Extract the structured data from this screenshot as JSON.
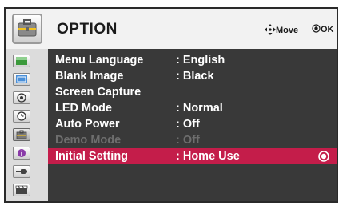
{
  "header": {
    "title": "OPTION",
    "icon": "option-toolbox-icon",
    "hint_move": "Move",
    "hint_move_icon": "dpad-arrows-icon",
    "hint_ok": "OK",
    "hint_ok_icon": "ok-button-icon"
  },
  "sidebar": {
    "items": [
      {
        "icon": "picture-icon",
        "selected": false
      },
      {
        "icon": "screen-icon",
        "selected": false
      },
      {
        "icon": "audio-icon",
        "selected": false
      },
      {
        "icon": "clock-icon",
        "selected": false
      },
      {
        "icon": "option-icon",
        "selected": true
      },
      {
        "icon": "info-icon",
        "selected": false
      },
      {
        "icon": "input-icon",
        "selected": false
      },
      {
        "icon": "media-icon",
        "selected": false
      }
    ]
  },
  "menu": {
    "items": [
      {
        "label": "Menu Language",
        "value": ": English",
        "state": "normal"
      },
      {
        "label": "Blank Image",
        "value": ": Black",
        "state": "normal"
      },
      {
        "label": "Screen Capture",
        "value": "",
        "state": "normal"
      },
      {
        "label": "LED Mode",
        "value": ": Normal",
        "state": "normal"
      },
      {
        "label": "Auto Power",
        "value": ": Off",
        "state": "normal"
      },
      {
        "label": "Demo Mode",
        "value": ": Off",
        "state": "disabled"
      },
      {
        "label": "Initial Setting",
        "value": ": Home Use",
        "state": "selected"
      }
    ]
  },
  "colors": {
    "selection": "#c41d4a",
    "panel_bg": "#393939",
    "header_bg": "#f2f2f2",
    "sidebar_bg": "#dcdcdc",
    "text": "#ffffff",
    "disabled_text": "#6e6e6e"
  }
}
